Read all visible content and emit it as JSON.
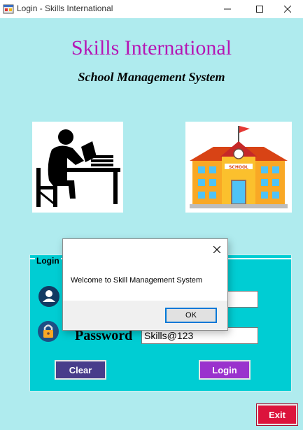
{
  "window": {
    "title": "Login - Skills International",
    "icon": "app-window-icon"
  },
  "header": {
    "title": "Skills International",
    "subtitle": "School Management System"
  },
  "images": {
    "left": "student-reading-icon",
    "right": "school-building-icon"
  },
  "login": {
    "group_label": "Login",
    "password_label": "Password",
    "username_value": "",
    "password_value": "Skills@123",
    "clear_label": "Clear",
    "login_label": "Login",
    "exit_label": "Exit"
  },
  "dialog": {
    "message": "Welcome to Skill Management System",
    "ok_label": "OK"
  },
  "colors": {
    "background": "#afebee",
    "group": "#00cdd3",
    "title": "#b516b5",
    "clear": "#483d8b",
    "login": "#9a32cd",
    "exit": "#dc143c"
  }
}
